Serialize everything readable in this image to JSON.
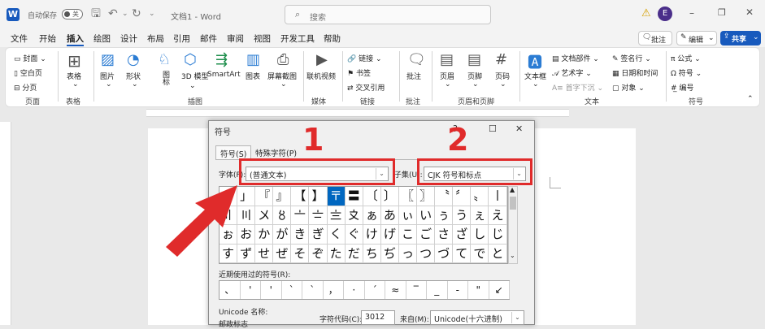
{
  "titlebar": {
    "autosave_label": "自动保存",
    "autosave_state": "关",
    "doc_title": "文档1 - Word",
    "search_placeholder": "搜索",
    "user_initial": "E"
  },
  "menu": {
    "tabs": [
      "文件",
      "开始",
      "插入",
      "绘图",
      "设计",
      "布局",
      "引用",
      "邮件",
      "审阅",
      "视图",
      "开发工具",
      "帮助"
    ],
    "active_tab": "插入",
    "comment_btn": "批注",
    "edit_btn": "编辑",
    "share_btn": "共享"
  },
  "ribbon": {
    "pages_group": {
      "label": "页面",
      "items": [
        "封面",
        "空白页",
        "分页"
      ]
    },
    "table_group": {
      "label": "表格",
      "item": "表格"
    },
    "illustrations_group": {
      "label": "插图",
      "items": [
        "图片",
        "形状",
        "图标",
        "3D 模型",
        "SmartArt",
        "图表",
        "屏幕截图"
      ]
    },
    "media_group": {
      "label": "媒体",
      "item": "联机视频"
    },
    "links_group": {
      "label": "链接",
      "items": [
        "链接",
        "书签",
        "交叉引用"
      ]
    },
    "comments_group": {
      "label": "批注",
      "item": "批注"
    },
    "header_footer_group": {
      "label": "页眉和页脚",
      "items": [
        "页眉",
        "页脚",
        "页码"
      ]
    },
    "text_group": {
      "label": "文本",
      "items": [
        "文本框",
        "文档部件",
        "艺术字",
        "首字下沉",
        "签名行",
        "日期和时间",
        "对象"
      ]
    },
    "symbols_group": {
      "label": "符号",
      "items": [
        "公式",
        "符号",
        "编号"
      ]
    }
  },
  "dialog": {
    "title": "符号",
    "tabs": [
      "符号(S)",
      "特殊字符(P)"
    ],
    "font_label": "字体(F):",
    "font_value": "(普通文本)",
    "subset_label": "子集(U):",
    "subset_value": "CJK 符号和标点",
    "symbol_rows": [
      [
        "「",
        "」",
        "『",
        "』",
        "【",
        "】",
        "〒",
        "〓",
        "〔",
        "〕",
        "〖",
        "〗",
        "〝",
        "〞",
        "〟",
        "〡"
      ],
      [
        "〢",
        "〣",
        "〤",
        "〥",
        "〦",
        "〧",
        "〨",
        "〩",
        "ぁ",
        "あ",
        "ぃ",
        "い",
        "ぅ",
        "う",
        "ぇ",
        "え"
      ],
      [
        "ぉ",
        "お",
        "か",
        "が",
        "き",
        "ぎ",
        "く",
        "ぐ",
        "け",
        "げ",
        "こ",
        "ご",
        "さ",
        "ざ",
        "し",
        "じ"
      ],
      [
        "す",
        "ず",
        "せ",
        "ぜ",
        "そ",
        "ぞ",
        "た",
        "だ",
        "ち",
        "ぢ",
        "っ",
        "つ",
        "づ",
        "て",
        "で",
        "と"
      ]
    ],
    "selected_symbol": "〒",
    "recent_label": "近期使用过的符号(R):",
    "recent_symbols": [
      "、",
      "'",
      "'",
      "`",
      "`",
      "，",
      "·",
      "´",
      "≈",
      "‾",
      "_",
      "-",
      "\"",
      "↙",
      "↘"
    ],
    "unicode_name_label": "Unicode 名称:",
    "unicode_name_value": "邮政标志",
    "char_code_label": "字符代码(C):",
    "char_code_value": "3012",
    "from_label": "来自(M):",
    "from_value": "Unicode(十六进制)"
  },
  "annotations": {
    "num1": "1",
    "num2": "2",
    "color": "#e02b2b"
  }
}
